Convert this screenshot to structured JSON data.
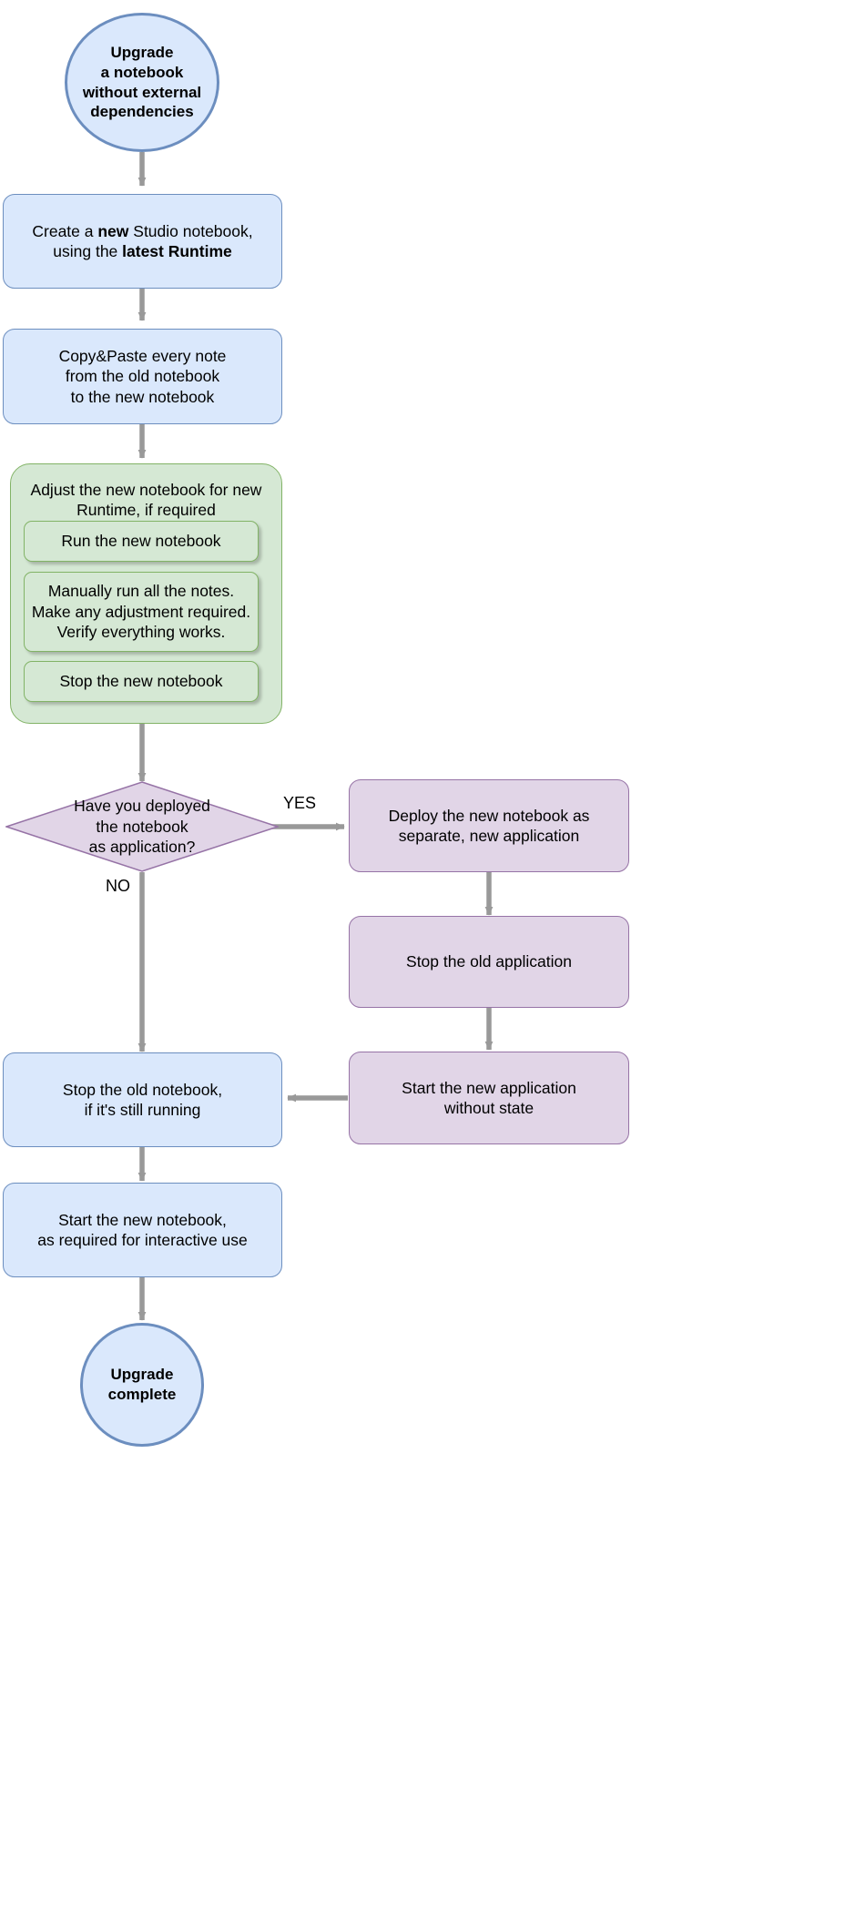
{
  "diagram": {
    "title": "Upgrade a notebook without external dependencies flowchart",
    "colors": {
      "blue_fill": "#dae8fc",
      "blue_stroke": "#6c8ebf",
      "green_fill": "#d5e8d4",
      "green_stroke": "#82b366",
      "purple_fill": "#e1d5e7",
      "purple_stroke": "#9673a6",
      "arrow": "#999999",
      "text": "#000000"
    },
    "nodes": {
      "start": {
        "shape": "circle",
        "label": "Upgrade\na notebook\nwithout external\ndependencies"
      },
      "create_new": {
        "shape": "rounded-rect",
        "label_parts": [
          "Create a ",
          "new",
          " Studio notebook,\nusing the ",
          "latest Runtime"
        ],
        "plain": "Create a new Studio notebook, using the latest Runtime"
      },
      "copy_paste": {
        "shape": "rounded-rect",
        "label": "Copy&Paste every note\nfrom the old notebook\nto the new notebook"
      },
      "adjust_group": {
        "shape": "group",
        "title": "Adjust the new notebook\nfor new Runtime, if required",
        "children": [
          {
            "label": "Run the new notebook"
          },
          {
            "label": "Manually run all the notes.\nMake any adjustment required.\nVerify everything works."
          },
          {
            "label": "Stop the new notebook"
          }
        ]
      },
      "decision": {
        "shape": "diamond",
        "label": "Have you deployed\nthe notebook\nas application?"
      },
      "deploy_new": {
        "shape": "rounded-rect",
        "label": "Deploy the new notebook as\nseparate, new application"
      },
      "stop_old_app": {
        "shape": "rounded-rect",
        "label": "Stop the old application"
      },
      "start_new_app": {
        "shape": "rounded-rect",
        "label": "Start the new application\nwithout state"
      },
      "stop_old_notebook": {
        "shape": "rounded-rect",
        "label": "Stop the old notebook,\nif it's still running"
      },
      "start_new_notebook": {
        "shape": "rounded-rect",
        "label": "Start the new notebook,\nas required for interactive use"
      },
      "end": {
        "shape": "circle",
        "label": "Upgrade\ncomplete"
      }
    },
    "edge_labels": {
      "yes": "YES",
      "no": "NO"
    }
  }
}
